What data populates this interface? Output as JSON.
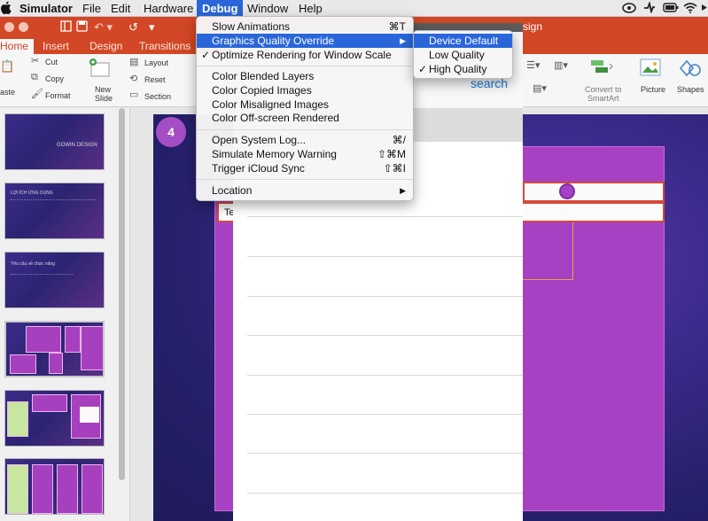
{
  "menubar": {
    "apple": "",
    "items": [
      "Simulator",
      "File",
      "Edit",
      "Hardware",
      "Debug",
      "Window",
      "Help"
    ],
    "active": "Debug"
  },
  "status_icons": [
    "creative-cloud-icon",
    "sync-icon",
    "battery-icon",
    "wifi-icon",
    "arrow-icon"
  ],
  "powerpoint": {
    "tabs": [
      "Home",
      "Insert",
      "Design",
      "Transitions"
    ],
    "selected_tab": "Home",
    "title_fragment": "sign",
    "ribbon": {
      "cut": "Cut",
      "copy": "Copy",
      "paste": "aste",
      "format": "Format",
      "new_slide_1": "New",
      "new_slide_2": "Slide",
      "layout": "Layout",
      "reset": "Reset",
      "section": "Section",
      "convert_1": "Convert to",
      "convert_2": "SmartArt",
      "picture": "Picture",
      "shapes": "Shapes"
    },
    "slide_number": "4",
    "slide_text_fragment": "Te",
    "thumbnails": [
      {
        "title": "GOWIN DESIGN"
      },
      {
        "title": "LỢI ÍCH ỨNG DỤNG"
      },
      {
        "title": "Yêu cầu về chức năng"
      },
      {
        "title": ""
      },
      {
        "title": ""
      },
      {
        "title": ""
      }
    ]
  },
  "simulator": {
    "search_label": "search"
  },
  "debug_menu": {
    "items": [
      {
        "label": "Slow Animations",
        "shortcut": "⌘T"
      },
      {
        "label": "Graphics Quality Override",
        "shortcut": "▶",
        "highlighted": true
      },
      {
        "label": "Optimize Rendering for Window Scale",
        "shortcut": "",
        "checked": true
      },
      {
        "label": "Color Blended Layers",
        "shortcut": ""
      },
      {
        "label": "Color Copied Images",
        "shortcut": ""
      },
      {
        "label": "Color Misaligned Images",
        "shortcut": ""
      },
      {
        "label": "Color Off-screen Rendered",
        "shortcut": ""
      },
      {
        "label": "Open System Log...",
        "shortcut": "⌘/"
      },
      {
        "label": "Simulate Memory Warning",
        "shortcut": "⇧⌘M"
      },
      {
        "label": "Trigger iCloud Sync",
        "shortcut": "⇧⌘I"
      },
      {
        "label": "Location",
        "shortcut": "▶"
      }
    ]
  },
  "graphics_submenu": {
    "items": [
      {
        "label": "Device Default",
        "highlighted": true,
        "checked": false
      },
      {
        "label": "Low Quality",
        "highlighted": false,
        "checked": false
      },
      {
        "label": "High Quality",
        "highlighted": false,
        "checked": true
      }
    ]
  },
  "colors": {
    "menu_highlight": "#2a66d9",
    "powerpoint_accent": "#d24726",
    "slide_box": "#a741c4",
    "search_blue": "#1a78d6"
  }
}
